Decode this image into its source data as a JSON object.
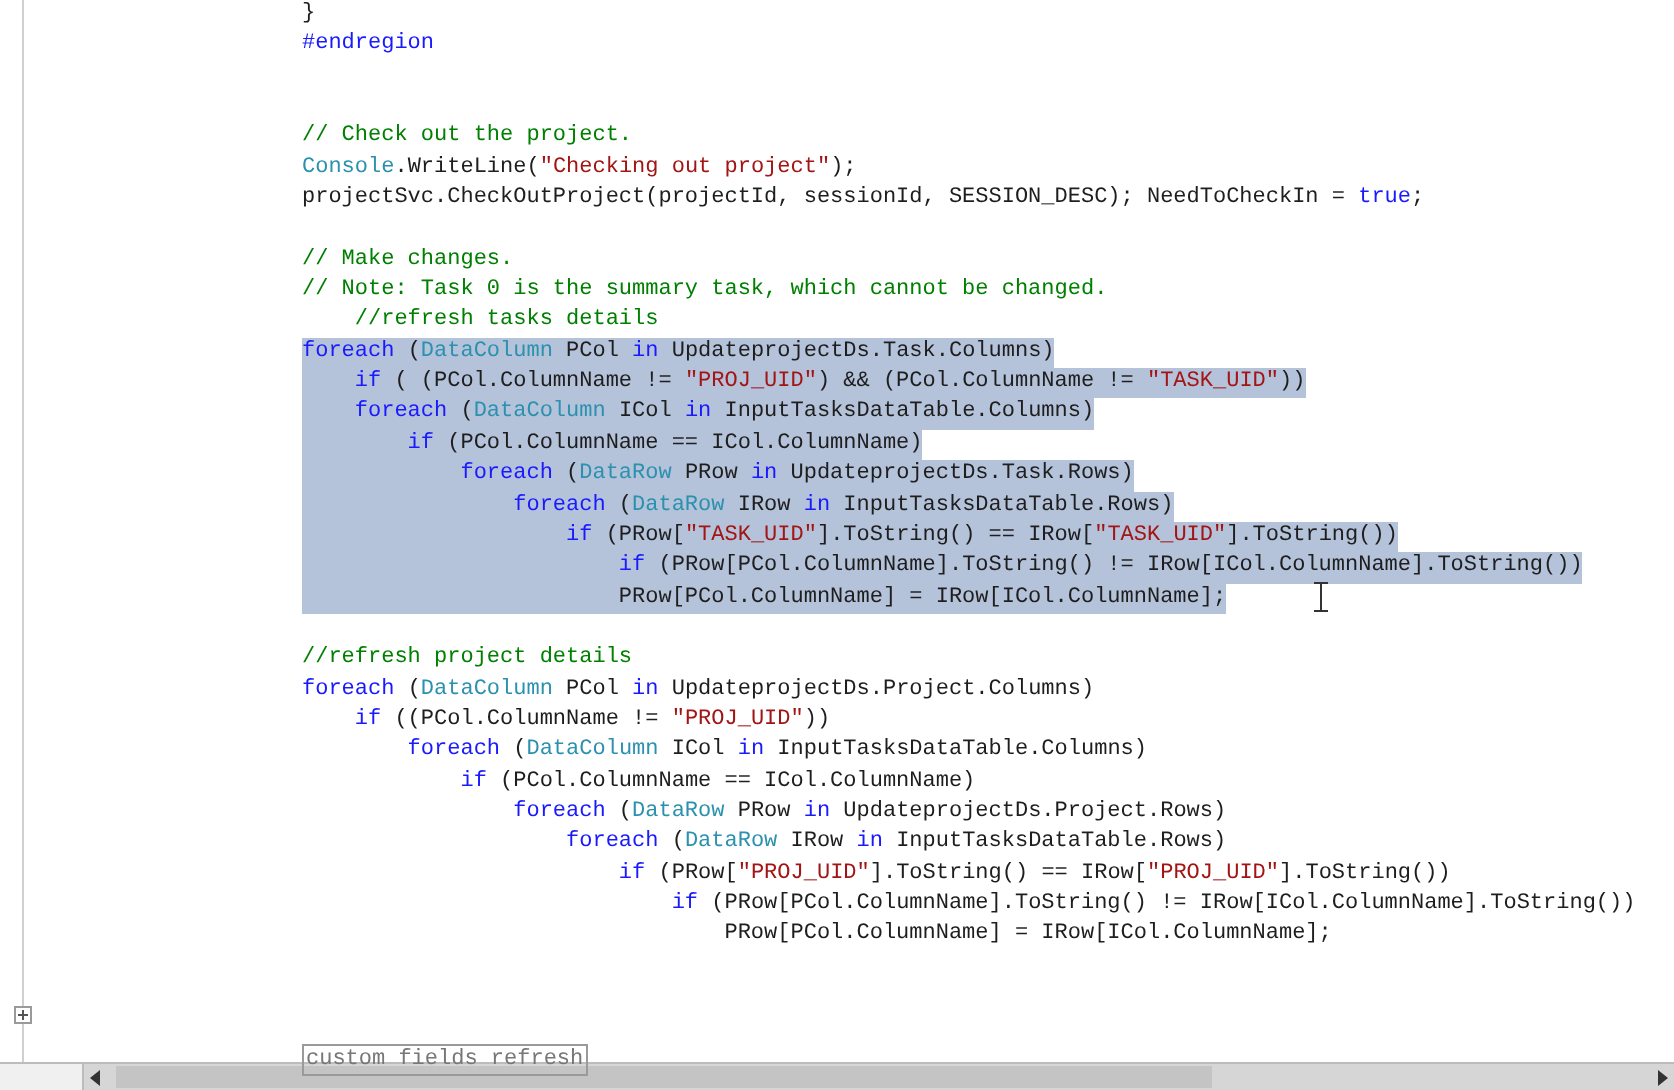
{
  "editor": {
    "lines": [
      {
        "kind": "code",
        "selected": false,
        "tokens": [
          {
            "text": "}",
            "kind": "plain"
          }
        ]
      },
      {
        "kind": "code",
        "selected": false,
        "tokens": [
          {
            "text": "#endregion",
            "kind": "keyword"
          }
        ]
      },
      {
        "kind": "blank"
      },
      {
        "kind": "blank"
      },
      {
        "kind": "code",
        "selected": false,
        "tokens": [
          {
            "text": "// Check out the project.",
            "kind": "comment"
          }
        ]
      },
      {
        "kind": "code",
        "selected": false,
        "tokens": [
          {
            "text": "Console",
            "kind": "type"
          },
          {
            "text": ".WriteLine(",
            "kind": "plain"
          },
          {
            "text": "\"Checking out project\"",
            "kind": "string"
          },
          {
            "text": ");",
            "kind": "plain"
          }
        ]
      },
      {
        "kind": "code",
        "selected": false,
        "tokens": [
          {
            "text": "projectSvc.CheckOutProject(projectId, sessionId, SESSION_DESC); NeedToCheckIn = ",
            "kind": "plain"
          },
          {
            "text": "true",
            "kind": "keyword"
          },
          {
            "text": ";",
            "kind": "plain"
          }
        ]
      },
      {
        "kind": "blank"
      },
      {
        "kind": "code",
        "selected": false,
        "tokens": [
          {
            "text": "// Make changes.",
            "kind": "comment"
          }
        ]
      },
      {
        "kind": "code",
        "selected": false,
        "tokens": [
          {
            "text": "// Note: Task 0 is the summary task, which cannot be changed.",
            "kind": "comment"
          }
        ]
      },
      {
        "kind": "code",
        "selected": false,
        "tokens": [
          {
            "text": "    //refresh tasks details",
            "kind": "comment"
          }
        ]
      },
      {
        "kind": "code",
        "selected": true,
        "tokens": [
          {
            "text": "foreach",
            "kind": "keyword"
          },
          {
            "text": " (",
            "kind": "plain"
          },
          {
            "text": "DataColumn",
            "kind": "type"
          },
          {
            "text": " PCol ",
            "kind": "plain"
          },
          {
            "text": "in",
            "kind": "keyword"
          },
          {
            "text": " UpdateprojectDs.Task.Columns)",
            "kind": "plain"
          }
        ]
      },
      {
        "kind": "code",
        "selected": true,
        "tokens": [
          {
            "text": "    if",
            "kind": "keyword"
          },
          {
            "text": " ( (PCol.ColumnName != ",
            "kind": "plain"
          },
          {
            "text": "\"PROJ_UID\"",
            "kind": "string"
          },
          {
            "text": ") && (PCol.ColumnName != ",
            "kind": "plain"
          },
          {
            "text": "\"TASK_UID\"",
            "kind": "string"
          },
          {
            "text": "))",
            "kind": "plain"
          }
        ]
      },
      {
        "kind": "code",
        "selected": true,
        "tokens": [
          {
            "text": "    foreach",
            "kind": "keyword"
          },
          {
            "text": " (",
            "kind": "plain"
          },
          {
            "text": "DataColumn",
            "kind": "type"
          },
          {
            "text": " ICol ",
            "kind": "plain"
          },
          {
            "text": "in",
            "kind": "keyword"
          },
          {
            "text": " InputTasksDataTable.Columns)",
            "kind": "plain"
          }
        ]
      },
      {
        "kind": "code",
        "selected": true,
        "tokens": [
          {
            "text": "        if",
            "kind": "keyword"
          },
          {
            "text": " (PCol.ColumnName == ICol.ColumnName)",
            "kind": "plain"
          }
        ]
      },
      {
        "kind": "code",
        "selected": true,
        "tokens": [
          {
            "text": "            foreach",
            "kind": "keyword"
          },
          {
            "text": " (",
            "kind": "plain"
          },
          {
            "text": "DataRow",
            "kind": "type"
          },
          {
            "text": " PRow ",
            "kind": "plain"
          },
          {
            "text": "in",
            "kind": "keyword"
          },
          {
            "text": " UpdateprojectDs.Task.Rows)",
            "kind": "plain"
          }
        ]
      },
      {
        "kind": "code",
        "selected": true,
        "tokens": [
          {
            "text": "                foreach",
            "kind": "keyword"
          },
          {
            "text": " (",
            "kind": "plain"
          },
          {
            "text": "DataRow",
            "kind": "type"
          },
          {
            "text": " IRow ",
            "kind": "plain"
          },
          {
            "text": "in",
            "kind": "keyword"
          },
          {
            "text": " InputTasksDataTable.Rows)",
            "kind": "plain"
          }
        ]
      },
      {
        "kind": "code",
        "selected": true,
        "tokens": [
          {
            "text": "                    if",
            "kind": "keyword"
          },
          {
            "text": " (PRow[",
            "kind": "plain"
          },
          {
            "text": "\"TASK_UID\"",
            "kind": "string"
          },
          {
            "text": "].ToString() == IRow[",
            "kind": "plain"
          },
          {
            "text": "\"TASK_UID\"",
            "kind": "string"
          },
          {
            "text": "].ToString())",
            "kind": "plain"
          }
        ]
      },
      {
        "kind": "code",
        "selected": true,
        "tokens": [
          {
            "text": "                        if",
            "kind": "keyword"
          },
          {
            "text": " (PRow[PCol.ColumnName].ToString() != IRow[ICol.ColumnName].ToString())",
            "kind": "plain"
          }
        ]
      },
      {
        "kind": "code",
        "selected": true,
        "tokens": [
          {
            "text": "                        PRow[PCol.ColumnName] = IRow[ICol.ColumnName];",
            "kind": "plain"
          }
        ]
      },
      {
        "kind": "blank"
      },
      {
        "kind": "code",
        "selected": false,
        "tokens": [
          {
            "text": "//refresh project details",
            "kind": "comment"
          }
        ]
      },
      {
        "kind": "code",
        "selected": false,
        "tokens": [
          {
            "text": "foreach",
            "kind": "keyword"
          },
          {
            "text": " (",
            "kind": "plain"
          },
          {
            "text": "DataColumn",
            "kind": "type"
          },
          {
            "text": " PCol ",
            "kind": "plain"
          },
          {
            "text": "in",
            "kind": "keyword"
          },
          {
            "text": " UpdateprojectDs.Project.Columns)",
            "kind": "plain"
          }
        ]
      },
      {
        "kind": "code",
        "selected": false,
        "tokens": [
          {
            "text": "    if",
            "kind": "keyword"
          },
          {
            "text": " ((PCol.ColumnName != ",
            "kind": "plain"
          },
          {
            "text": "\"PROJ_UID\"",
            "kind": "string"
          },
          {
            "text": "))",
            "kind": "plain"
          }
        ]
      },
      {
        "kind": "code",
        "selected": false,
        "tokens": [
          {
            "text": "        foreach",
            "kind": "keyword"
          },
          {
            "text": " (",
            "kind": "plain"
          },
          {
            "text": "DataColumn",
            "kind": "type"
          },
          {
            "text": " ICol ",
            "kind": "plain"
          },
          {
            "text": "in",
            "kind": "keyword"
          },
          {
            "text": " InputTasksDataTable.Columns)",
            "kind": "plain"
          }
        ]
      },
      {
        "kind": "code",
        "selected": false,
        "tokens": [
          {
            "text": "            if",
            "kind": "keyword"
          },
          {
            "text": " (PCol.ColumnName == ICol.ColumnName)",
            "kind": "plain"
          }
        ]
      },
      {
        "kind": "code",
        "selected": false,
        "tokens": [
          {
            "text": "                foreach",
            "kind": "keyword"
          },
          {
            "text": " (",
            "kind": "plain"
          },
          {
            "text": "DataRow",
            "kind": "type"
          },
          {
            "text": " PRow ",
            "kind": "plain"
          },
          {
            "text": "in",
            "kind": "keyword"
          },
          {
            "text": " UpdateprojectDs.Project.Rows)",
            "kind": "plain"
          }
        ]
      },
      {
        "kind": "code",
        "selected": false,
        "tokens": [
          {
            "text": "                    foreach",
            "kind": "keyword"
          },
          {
            "text": " (",
            "kind": "plain"
          },
          {
            "text": "DataRow",
            "kind": "type"
          },
          {
            "text": " IRow ",
            "kind": "plain"
          },
          {
            "text": "in",
            "kind": "keyword"
          },
          {
            "text": " InputTasksDataTable.Rows)",
            "kind": "plain"
          }
        ]
      },
      {
        "kind": "code",
        "selected": false,
        "tokens": [
          {
            "text": "                        if",
            "kind": "keyword"
          },
          {
            "text": " (PRow[",
            "kind": "plain"
          },
          {
            "text": "\"PROJ_UID\"",
            "kind": "string"
          },
          {
            "text": "].ToString() == IRow[",
            "kind": "plain"
          },
          {
            "text": "\"PROJ_UID\"",
            "kind": "string"
          },
          {
            "text": "].ToString())",
            "kind": "plain"
          }
        ]
      },
      {
        "kind": "code",
        "selected": false,
        "tokens": [
          {
            "text": "                            if",
            "kind": "keyword"
          },
          {
            "text": " (PRow[PCol.ColumnName].ToString() != IRow[ICol.ColumnName].ToString())",
            "kind": "plain"
          }
        ]
      },
      {
        "kind": "code",
        "selected": false,
        "tokens": [
          {
            "text": "                                PRow[PCol.ColumnName] = IRow[ICol.ColumnName];",
            "kind": "plain"
          }
        ]
      },
      {
        "kind": "blank"
      },
      {
        "kind": "blank"
      },
      {
        "kind": "blank"
      },
      {
        "kind": "collapsed",
        "text": "custom fields refresh"
      }
    ]
  }
}
